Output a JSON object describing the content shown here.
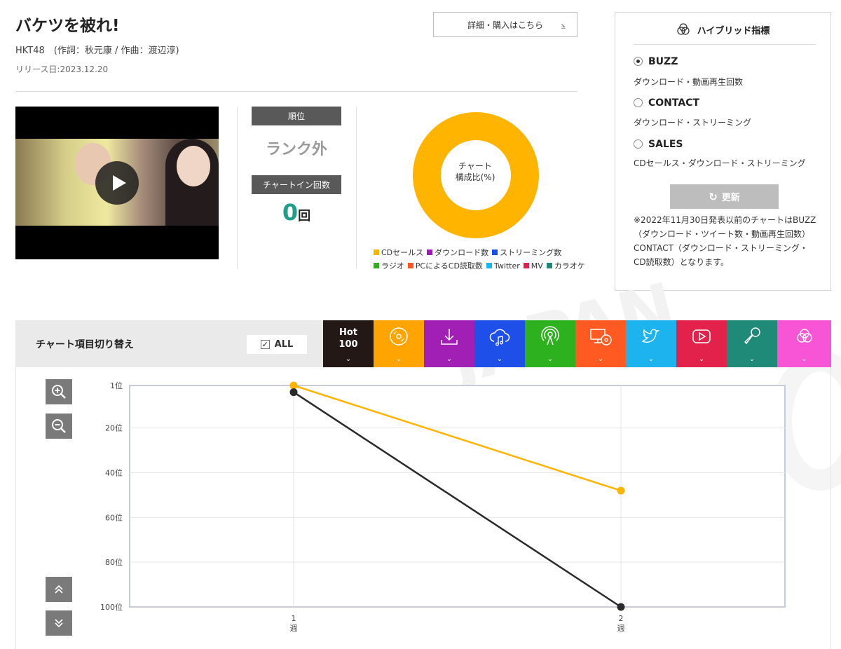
{
  "song": {
    "title": "バケツを被れ!",
    "artist_line": "HKT48　(作詞：秋元康 / 作曲：渡辺淳)",
    "release": "リリース日:2023.12.20"
  },
  "detail_button": {
    "label": "詳細・購入はこちら",
    "icon": "external-arrow-icon"
  },
  "video": {
    "icon": "play-icon"
  },
  "rank": {
    "label": "順位",
    "value": "ランク外"
  },
  "chart_in": {
    "label": "チャートイン回数",
    "count": "0",
    "unit": "回"
  },
  "donut": {
    "label_line1": "チャート",
    "label_line2": "構成比(%)",
    "color": "#FFB400"
  },
  "legend": [
    {
      "label": "CDセールス",
      "color": "#FFB400"
    },
    {
      "label": "ダウンロード数",
      "color": "#9B1CB0"
    },
    {
      "label": "ストリーミング数",
      "color": "#1A4CE6"
    },
    {
      "label": "ラジオ",
      "color": "#2FAF1E"
    },
    {
      "label": "PCによるCD読取数",
      "color": "#FF5522"
    },
    {
      "label": "Twitter",
      "color": "#1AB4F0"
    },
    {
      "label": "MV",
      "color": "#E0204A"
    },
    {
      "label": "カラオケ",
      "color": "#1F8A78"
    }
  ],
  "hybrid": {
    "title": "ハイブリッド指標",
    "options": [
      {
        "name": "BUZZ",
        "desc": "ダウンロード・動画再生回数",
        "selected": true
      },
      {
        "name": "CONTACT",
        "desc": "ダウンロード・ストリーミング",
        "selected": false
      },
      {
        "name": "SALES",
        "desc": "CDセールス・ダウンロード・ストリーミング",
        "selected": false
      }
    ],
    "update_label": "更新",
    "note": "※2022年11月30日発表以前のチャートはBUZZ（ダウンロード・ツイート数・動画再生回数）CONTACT（ダウンロード・ストリーミング・CD読取数）となります。"
  },
  "switcher": {
    "title": "チャート項目切り替え",
    "all_label": "ALL",
    "all_checked": true,
    "tabs": [
      {
        "id": "hot100",
        "label_line1": "Hot",
        "label_line2": "100",
        "color": "#231816",
        "icon": "hot100-label"
      },
      {
        "id": "cd",
        "color": "#FFA400",
        "icon": "cd-icon"
      },
      {
        "id": "download",
        "color": "#A21FB5",
        "icon": "download-icon"
      },
      {
        "id": "streaming",
        "color": "#1E4FE8",
        "icon": "cloud-music-icon"
      },
      {
        "id": "radio",
        "color": "#2EB11F",
        "icon": "radio-icon"
      },
      {
        "id": "pc",
        "color": "#FF5A22",
        "icon": "pc-cd-icon"
      },
      {
        "id": "twitter",
        "color": "#1DB3EF",
        "icon": "twitter-icon"
      },
      {
        "id": "youtube",
        "color": "#E3224C",
        "icon": "youtube-icon"
      },
      {
        "id": "karaoke",
        "color": "#1E8A77",
        "icon": "microphone-icon"
      },
      {
        "id": "hybrid",
        "color": "#F755D6",
        "icon": "hybrid-circles-icon"
      }
    ]
  },
  "chart_data": {
    "type": "line",
    "x": [
      1,
      2
    ],
    "xticks": [
      "1週",
      "2週"
    ],
    "yticks": [
      "1位",
      "20位",
      "40位",
      "60位",
      "80位",
      "100位"
    ],
    "ylim": [
      1,
      100
    ],
    "y_inverted": true,
    "grid": true,
    "series": [
      {
        "color": "#FFB400",
        "values": [
          1,
          48
        ]
      },
      {
        "color": "#2A2A2A",
        "values": [
          4,
          100
        ]
      }
    ]
  }
}
